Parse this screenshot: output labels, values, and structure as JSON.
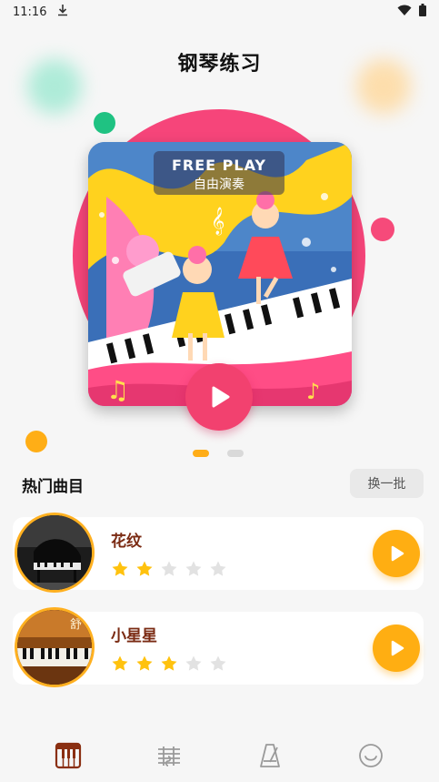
{
  "status_bar": {
    "time": "11:16",
    "icons": [
      "download-icon",
      "wifi-icon",
      "battery-icon"
    ]
  },
  "header": {
    "title": "钢琴练习"
  },
  "featured": {
    "label_en": "FREE PLAY",
    "label_cn": "自由演奏",
    "page_count": 2,
    "active_page": 1
  },
  "hot_songs": {
    "title": "热门曲目",
    "refresh_label": "换一批",
    "items": [
      {
        "name": "花纹",
        "stars_filled": 2,
        "stars_total": 5
      },
      {
        "name": "小星星",
        "stars_filled": 3,
        "stars_total": 5
      }
    ]
  },
  "bottom_nav": {
    "items": [
      {
        "icon": "piano-keys-icon",
        "active": true
      },
      {
        "icon": "sheet-music-icon",
        "active": false
      },
      {
        "icon": "metronome-icon",
        "active": false
      },
      {
        "icon": "smiley-icon",
        "active": false
      }
    ]
  },
  "colors": {
    "accent": "#ffae16",
    "pink": "#f6457a",
    "active_nav": "#8a2f12",
    "inactive_nav": "#9a9a9a",
    "song_name": "#7a2a12"
  }
}
